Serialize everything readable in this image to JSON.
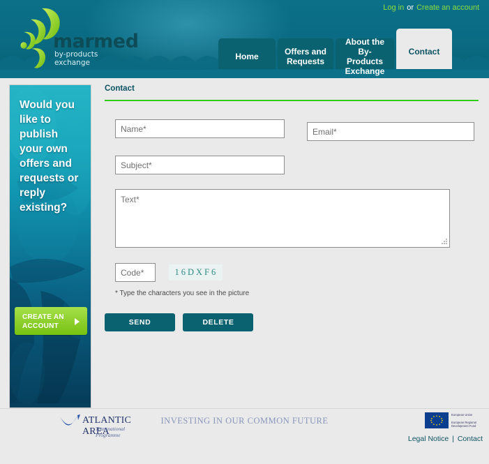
{
  "brand": {
    "logo_word": "marmed",
    "logo_tagline": "by-products exchange",
    "logo_icon": "green-wave-crescents-logo"
  },
  "colors": {
    "header_teal": "#0a6c84",
    "tab_teal": "#0a6170",
    "active_tab_bg": "#eaeaea",
    "accent_green": "#2fcc1a",
    "link_green": "#8ede3c",
    "heading_teal": "#0d5362",
    "captcha_text": "#2d8c84",
    "page_bg": "#eaeaea",
    "button_teal": "#0a6170",
    "cta_green": "#8ed02e",
    "footer_blue": "#24356d",
    "footer_slogan": "#8a95bd"
  },
  "topbar": {
    "login_label": "Log in",
    "separator": "or",
    "create_account_label": "Create an account"
  },
  "nav": {
    "tabs": [
      {
        "label": "Home",
        "active": false
      },
      {
        "label": "Offers and\nRequests",
        "active": false
      },
      {
        "label": "About the\nBy-Products\nExchange",
        "active": false
      },
      {
        "label": "Contact",
        "active": true
      }
    ]
  },
  "sidebar": {
    "promo_heading": "Would you like to publish your own offers and requests or reply existing?",
    "cta_label": "CREATE AN ACCOUNT",
    "cta_icon": "play-arrow-icon",
    "background_image": "underwater-fish-photo"
  },
  "main": {
    "page_title": "Contact",
    "form": {
      "name": {
        "value": "",
        "placeholder": "Name*"
      },
      "email": {
        "value": "",
        "placeholder": "Email*"
      },
      "subject": {
        "value": "",
        "placeholder": "Subject*"
      },
      "text": {
        "value": "",
        "placeholder": "Text*"
      },
      "code": {
        "value": "",
        "placeholder": "Code*"
      },
      "captcha_code": "16DXF6",
      "captcha_hint": "* Type the characters you see in the picture",
      "send_label": "SEND",
      "delete_label": "DELETE",
      "resize_handle_icon": "resize-handle-icon"
    }
  },
  "footer": {
    "atlantic_logo_icon": "atlantic-area-swoosh-logo",
    "atlantic_name": "ATLANTIC AREA",
    "atlantic_sub": "Transnational Programme",
    "slogan": "INVESTING IN OUR COMMON FUTURE",
    "eu_flag_icon": "eu-flag-icon",
    "eu_line1": "European Union",
    "eu_line2": "European Regional Development Fund",
    "legal_notice_label": "Legal Notice",
    "links_separator": "|",
    "contact_label": "Contact"
  }
}
